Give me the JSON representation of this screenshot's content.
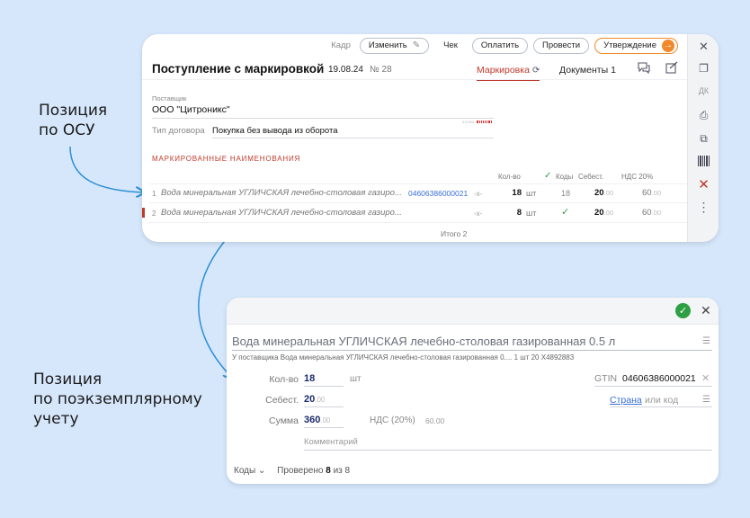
{
  "captions": {
    "first_line1": "Позиция",
    "first_line2": "по ОСУ",
    "second_line1": "Позиция",
    "second_line2": "по поэкземплярному",
    "second_line3": "учету"
  },
  "toolbar": {
    "kadr_label": "Кадр",
    "edit_label": "Изменить",
    "check_label": "Чек",
    "pay_label": "Оплатить",
    "post_label": "Провести",
    "approve_label": "Утверждение"
  },
  "document": {
    "title": "Поступление с маркировкой",
    "date": "19.08.24",
    "number": "№ 28",
    "tab_marking": "Маркировка",
    "tab_documents": "Документы",
    "documents_count": "1"
  },
  "supplier": {
    "label": "Поставщик",
    "value": "ООО \"Цитроникс\"",
    "mini_bar_text": "510406"
  },
  "contract": {
    "label": "Тип договора",
    "value": "Покупка без вывода из оборота"
  },
  "section_title": "МАРКИРОВАННЫЕ НАИМЕНОВАНИЯ",
  "table": {
    "headers": {
      "qty": "Кол-во",
      "codes": "Коды",
      "cost": "Себест.",
      "vat": "НДС 20%"
    },
    "rows": [
      {
        "num": "1",
        "name": "Вода минеральная УГЛИЧСКАЯ лечебно-столовая газиро...",
        "code": "04606386000021",
        "dash": "-x-",
        "qty": "18",
        "unit": "шт",
        "codes": "18",
        "cost_int": "20",
        "cost_frac": ".00",
        "vat_int": "60",
        "vat_frac": ".00"
      },
      {
        "num": "2",
        "name": "Вода минеральная УГЛИЧСКАЯ лечебно-столовая газиро...",
        "code": "",
        "dash": "-x-",
        "qty": "8",
        "unit": "шт",
        "codes": "✓",
        "cost_int": "20",
        "cost_frac": ".00",
        "vat_int": "60",
        "vat_frac": ".00"
      }
    ],
    "total": "Итого 2"
  },
  "sidebar_icons": [
    "close-icon",
    "copy-icon",
    "dk-label",
    "print-icon",
    "files-icon",
    "barcode-icon",
    "delete-icon",
    "more-icon"
  ],
  "sidebar_dk": "ДК",
  "item": {
    "title": "Вода минеральная УГЛИЧСКАЯ лечебно-столовая газированная 0.5 л",
    "supplier_line": "У поставщика  Вода минеральная УГЛИЧСКАЯ лечебно-столовая газированная 0....    1 шт 20 X4892883",
    "qty_label": "Кол-во",
    "qty_value": "18",
    "qty_unit": "шт",
    "cost_label": "Себест.",
    "cost_int": "20",
    "cost_frac": ".00",
    "sum_label": "Сумма",
    "sum_int": "360",
    "sum_frac": ".00",
    "vat_label": "НДС (20%)",
    "vat_value": "60.00",
    "gtin_label": "GTIN",
    "gtin_value": "04606386000021",
    "country_label": "Страна",
    "country_placeholder": "или код",
    "comment_placeholder": "Комментарий",
    "codes_label": "Коды",
    "verified_label": "Проверено",
    "verified_count": "8",
    "verified_of": "из",
    "verified_total": "8"
  },
  "colors": {
    "background": "#d6e7fb",
    "accent_red": "#c0392b",
    "accent_orange": "#f08a2c",
    "link_blue": "#3a6fd8",
    "ok_green": "#2ea043",
    "arrow_blue": "#2b8fd6"
  }
}
